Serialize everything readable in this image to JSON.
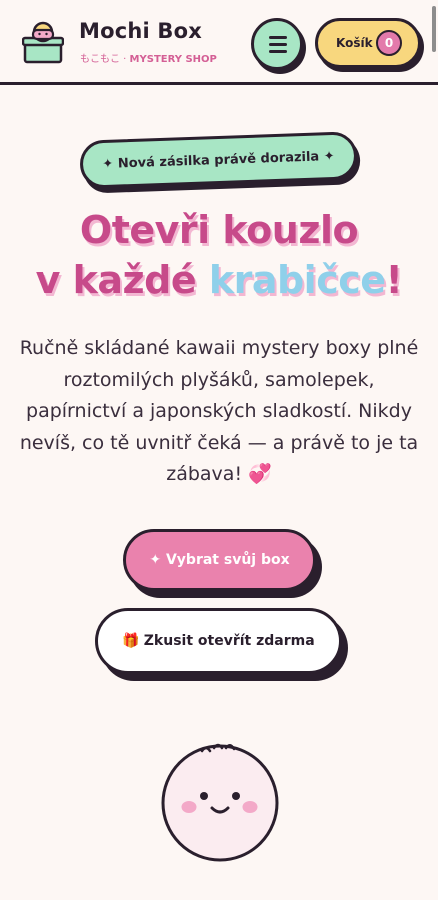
{
  "header": {
    "brand_title": "Mochi Box",
    "brand_sub_jp": "もこもこ · ",
    "brand_sub_en": "MYSTERY SHOP",
    "menu_icon": "hamburger-icon",
    "cart_label": "Košík",
    "cart_count": "0"
  },
  "hero": {
    "badge": "✦ Nová zásilka právě dorazila ✦",
    "title_line1": "Otevři kouzlo",
    "title_line2_a": "v každé ",
    "title_line2_accent": "krabičce",
    "title_line2_end": "!",
    "description": "Ručně skládané kawaii mystery boxy plné roztomilých plyšáků, samolepek, papírnictví a japonských sladkostí. Nikdy nevíš, co tě uvnitř čeká — a právě to je ta zábava! 💞",
    "primary_button": "✦ Vybrat svůj box",
    "secondary_button_icon": "🎁",
    "secondary_button": "Zkusit otevřít zdarma"
  },
  "colors": {
    "background": "#fdf7f4",
    "mint": "#a8e6c5",
    "yellow": "#f8d77e",
    "pink": "#ea82ad",
    "title_pink": "#c74a8a",
    "accent_blue": "#8fd0ea",
    "outline": "#2a1f2d"
  }
}
